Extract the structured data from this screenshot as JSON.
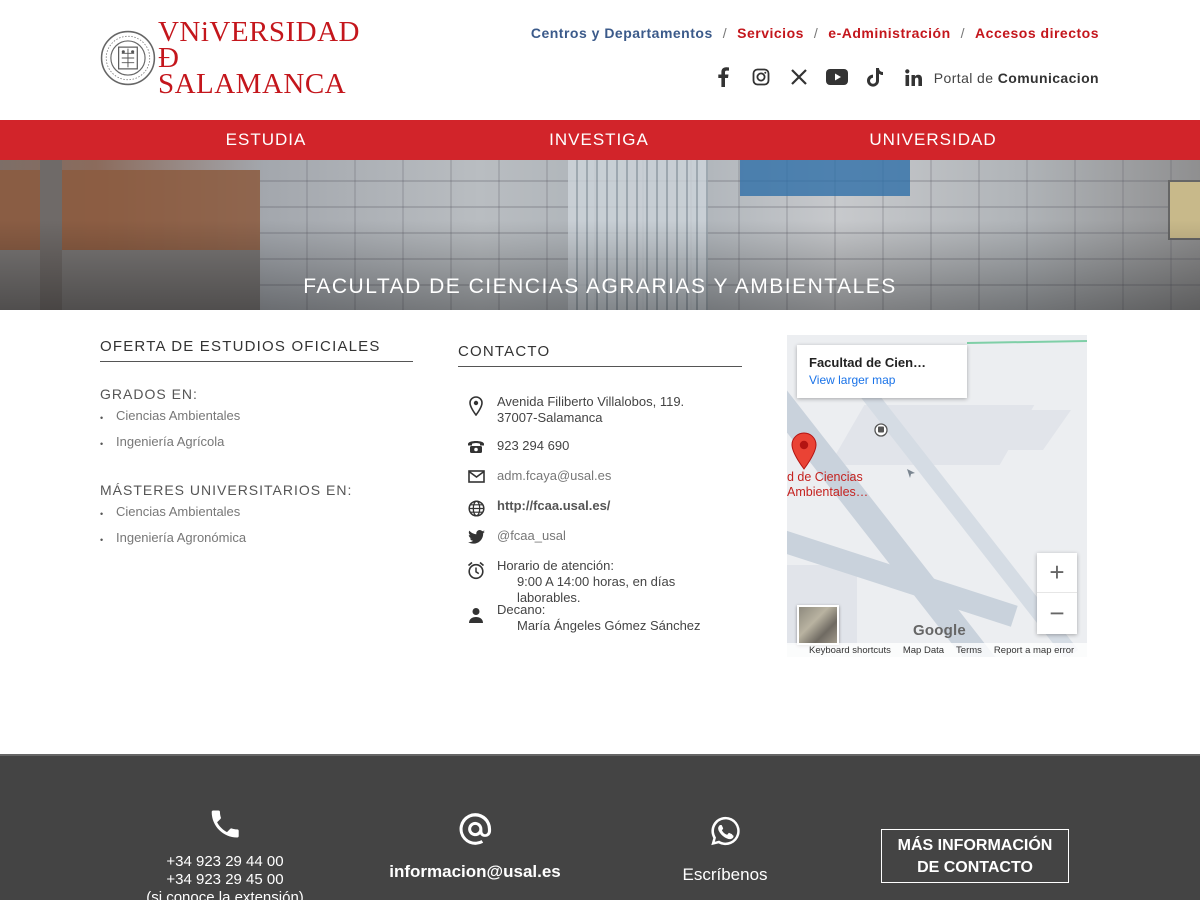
{
  "logo": {
    "line1": "VNiVERSIDAD",
    "line2": "Đ SALAMANCA"
  },
  "topnav": {
    "items": [
      {
        "label": "Centros y Departamentos",
        "color": "#3b5a8a"
      },
      {
        "label": "Servicios",
        "color": "#c4161c"
      },
      {
        "label": "e-Administración",
        "color": "#c4161c"
      },
      {
        "label": "Accesos directos",
        "color": "#c4161c"
      }
    ],
    "separator": "/"
  },
  "social": [
    "facebook-icon",
    "instagram-icon",
    "x-icon",
    "youtube-icon",
    "tiktok-icon",
    "linkedin-icon"
  ],
  "portal": {
    "prefix": "Portal de",
    "name": "Comunicacion"
  },
  "mainnav": {
    "items": [
      "ESTUDIA",
      "INVESTIGA",
      "UNIVERSIDAD"
    ],
    "color": "#d2242a"
  },
  "banner": {
    "title": "FACULTAD DE CIENCIAS AGRARIAS Y AMBIENTALES"
  },
  "studies": {
    "title": "OFERTA DE ESTUDIOS OFICIALES",
    "grados_label": "GRADOS EN:",
    "grados": [
      "Ciencias Ambientales",
      "Ingeniería Agrícola"
    ],
    "masteres_label": "MÁSTERES UNIVERSITARIOS EN:",
    "masteres": [
      "Ciencias Ambientales",
      "Ingeniería Agronómica"
    ]
  },
  "contact": {
    "title": "CONTACTO",
    "address_line1": "Avenida Filiberto Villalobos, 119.",
    "address_line2": "37007-Salamanca",
    "phone": "923 294 690",
    "email": "adm.fcaya@usal.es",
    "web": "http://fcaa.usal.es/",
    "twitter": "@fcaa_usal",
    "hours_label": "Horario de atención:",
    "hours_value": "9:00 A 14:00 horas, en días laborables.",
    "dean_label": "Decano:",
    "dean_value": "María Ángeles Gómez Sánchez"
  },
  "map": {
    "card_title": "Facultad de Cien…",
    "card_link": "View larger map",
    "pin_label_1": "d de Ciencias",
    "pin_label_2": "Ambientales…",
    "zoom_in": "+",
    "zoom_out": "−",
    "google": "Google",
    "attrib": [
      "Keyboard shortcuts",
      "Map Data",
      "Terms",
      "Report a map error"
    ]
  },
  "footer": {
    "phone1": "+34 923 29 44 00",
    "phone2": "+34 923 29 45 00",
    "phone_note": "(si conoce la extensión)",
    "email": "informacion@usal.es",
    "whatsapp": "Escríbenos",
    "more_line1": "MÁS INFORMACIÓN",
    "more_line2": "DE CONTACTO"
  }
}
